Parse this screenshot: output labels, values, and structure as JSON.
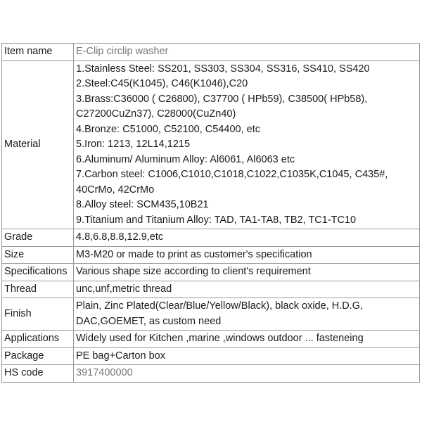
{
  "table": {
    "rows": [
      {
        "label": "Item name",
        "value": "E-Clip circlip washer"
      },
      {
        "label": "Material",
        "lines": [
          "1.Stainless Steel: SS201, SS303, SS304, SS316, SS410, SS420",
          "2.Steel:C45(K1045), C46(K1046),C20",
          "3.Brass:C36000 ( C26800), C37700 ( HPb59), C38500( HPb58),",
          "C27200CuZn37), C28000(CuZn40)",
          "4.Bronze: C51000, C52100, C54400, etc",
          "5.Iron: 1213, 12L14,1215",
          "6.Aluminum/ Aluminum Alloy: Al6061, Al6063 etc",
          "7.Carbon steel: C1006,C1010,C1018,C1022,C1035K,C1045, C435#,",
          "40CrMo, 42CrMo",
          "8.Alloy steel: SCM435,10B21",
          "9.Titanium and Titanium Alloy: TAD, TA1-TA8, TB2, TC1-TC10"
        ]
      },
      {
        "label": "Grade",
        "value": "4.8,6.8,8.8,12.9,etc"
      },
      {
        "label": "Size",
        "value": "M3-M20 or made to print as customer's specification"
      },
      {
        "label": "Specifications",
        "value": "Various shape size according to client's requirement"
      },
      {
        "label": "Thread",
        "value": "unc,unf,metric thread"
      },
      {
        "label": "Finish",
        "lines": [
          "Plain, Zinc Plated(Clear/Blue/Yellow/Black), black oxide, H.D.G,",
          "DAC,GOEMET, as custom need"
        ]
      },
      {
        "label": "Applications",
        "value": "Widely used for Kitchen ,marine ,windows outdoor ... fasteneing"
      },
      {
        "label": "Package",
        "value": "PE bag+Carton box"
      },
      {
        "label": "HS code",
        "value": "3917400000"
      }
    ]
  }
}
